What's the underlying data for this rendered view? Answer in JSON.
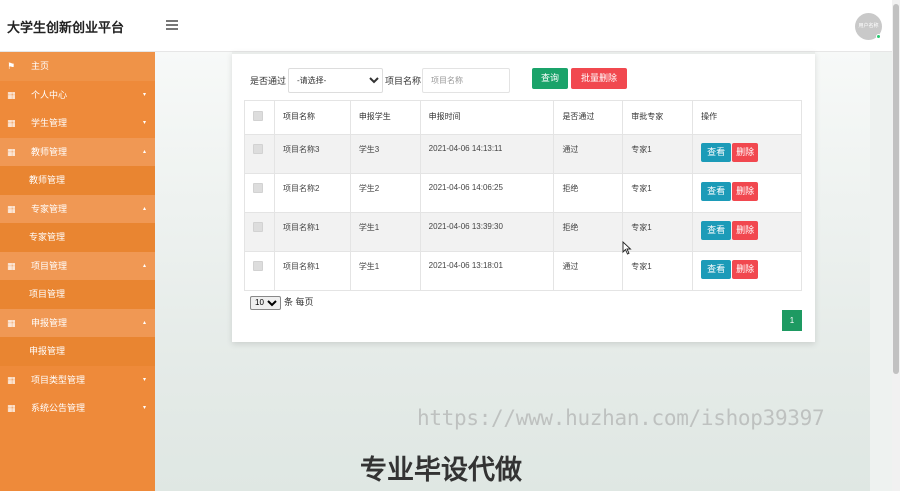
{
  "app": {
    "title": "大学生创新创业平台",
    "avatar_text": "用户名称"
  },
  "sidebar": {
    "items": [
      {
        "label": "主页",
        "icon": "flag-icon",
        "state": "home"
      },
      {
        "label": "个人中心",
        "icon": "grid-icon",
        "caret": "▾"
      },
      {
        "label": "学生管理",
        "icon": "grid-icon",
        "caret": "▾"
      },
      {
        "label": "教师管理",
        "icon": "grid-icon",
        "caret": "▴",
        "state": "open"
      },
      {
        "label": "教师管理",
        "state": "sub"
      },
      {
        "label": "专家管理",
        "icon": "grid-icon",
        "caret": "▴",
        "state": "open"
      },
      {
        "label": "专家管理",
        "state": "sub"
      },
      {
        "label": "项目管理",
        "icon": "grid-icon",
        "caret": "▴",
        "state": "open"
      },
      {
        "label": "项目管理",
        "state": "sub"
      },
      {
        "label": "申报管理",
        "icon": "grid-icon",
        "caret": "▴",
        "state": "open"
      },
      {
        "label": "申报管理",
        "state": "sub"
      },
      {
        "label": "项目类型管理",
        "icon": "grid-icon",
        "caret": "▾"
      },
      {
        "label": "系统公告管理",
        "icon": "grid-icon",
        "caret": "▾"
      }
    ]
  },
  "filters": {
    "passed_label": "是否通过",
    "passed_selected": "-请选择-",
    "name_label": "项目名称",
    "name_placeholder": "项目名称",
    "query_button": "查询",
    "bulk_delete_button": "批量删除"
  },
  "table": {
    "headers": [
      "项目名称",
      "申报学生",
      "申报时间",
      "是否通过",
      "审批专家",
      "操作"
    ],
    "rows": [
      {
        "name": "项目名称3",
        "student": "学生3",
        "time": "2021-04-06 14:13:11",
        "passed": "通过",
        "expert": "专家1"
      },
      {
        "name": "项目名称2",
        "student": "学生2",
        "time": "2021-04-06 14:06:25",
        "passed": "拒绝",
        "expert": "专家1"
      },
      {
        "name": "项目名称1",
        "student": "学生1",
        "time": "2021-04-06 13:39:30",
        "passed": "拒绝",
        "expert": "专家1"
      },
      {
        "name": "项目名称1",
        "student": "学生1",
        "time": "2021-04-06 13:18:01",
        "passed": "通过",
        "expert": "专家1"
      }
    ],
    "view_label": "查看",
    "delete_label": "删除"
  },
  "pagination": {
    "page_size": "10",
    "per_page_label": "条 每页",
    "current_page": "1"
  },
  "overlay": {
    "watermark": "https://www.huzhan.com/ishop39397",
    "slogan": "专业毕设代做"
  },
  "colors": {
    "sidebar": "#ee8a3a",
    "primary_green": "#1aa36a",
    "danger": "#f1484f",
    "info": "#1c9bb8"
  }
}
